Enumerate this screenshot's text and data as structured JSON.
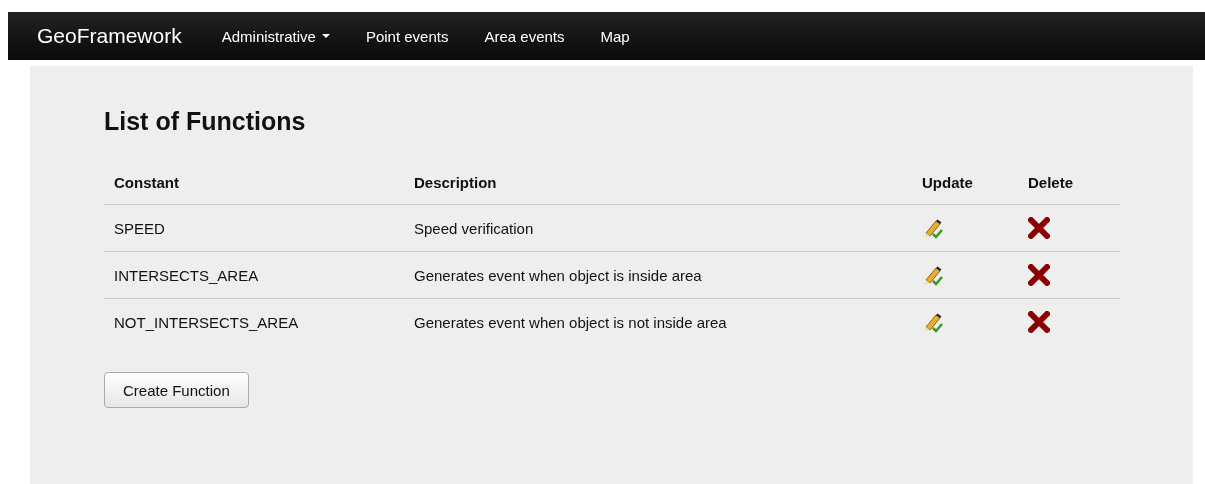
{
  "navbar": {
    "brand": "GeoFramework",
    "items": [
      {
        "label": "Administrative",
        "kind": "dropdown"
      },
      {
        "label": "Point events",
        "kind": "link"
      },
      {
        "label": "Area events",
        "kind": "link"
      },
      {
        "label": "Map",
        "kind": "link"
      }
    ]
  },
  "title": "List of Functions",
  "table": {
    "columns": [
      "Constant",
      "Description",
      "Update",
      "Delete"
    ],
    "rows": [
      {
        "constant": "SPEED",
        "description": "Speed verification"
      },
      {
        "constant": "INTERSECTS_AREA",
        "description": "Generates event when object is inside area"
      },
      {
        "constant": "NOT_INTERSECTS_AREA",
        "description": "Generates event when object is not inside area"
      }
    ]
  },
  "create_button": "Create Function"
}
